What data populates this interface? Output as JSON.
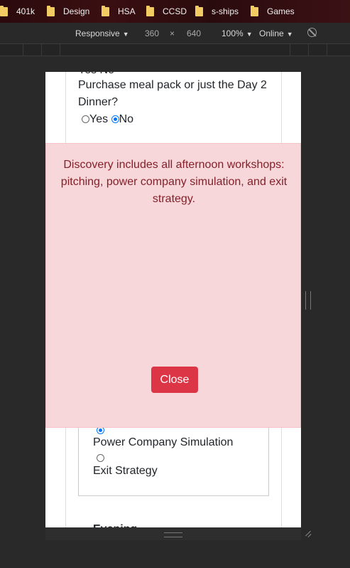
{
  "bookmarks": [
    {
      "label": "401k",
      "icon": "folder-icon"
    },
    {
      "label": "Design",
      "icon": "folder-icon"
    },
    {
      "label": "HSA",
      "icon": "folder-icon"
    },
    {
      "label": "CCSD",
      "icon": "folder-icon"
    },
    {
      "label": "s-ships",
      "icon": "folder-icon"
    },
    {
      "label": "Games",
      "icon": "folder-icon"
    }
  ],
  "device_toolbar": {
    "device": "Responsive",
    "width": "360",
    "times": "×",
    "height": "640",
    "zoom": "100%",
    "network": "Online"
  },
  "page": {
    "partial_text": "Yes No",
    "question": "Purchase meal pack or just the Day 2 Dinner?",
    "yes_label": "Yes",
    "no_label": "No",
    "power_label": "Power Company Simulation",
    "exit_label": "Exit Strategy",
    "evening_label": "Evening"
  },
  "modal": {
    "message": "Discovery includes all afternoon workshops: pitching, power company simulation, and exit strategy.",
    "close_label": "Close"
  },
  "colors": {
    "modal_bg": "#f8d7da",
    "modal_text": "#842029",
    "close_button": "#dc3545",
    "radio_checked": "#0075ff"
  }
}
